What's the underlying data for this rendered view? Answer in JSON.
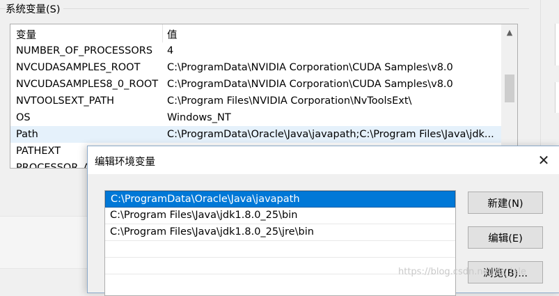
{
  "system_vars": {
    "group_title": "系统变量(S)",
    "header_variable": "变量",
    "header_value": "值",
    "rows": [
      {
        "name": "NUMBER_OF_PROCESSORS",
        "value": "4"
      },
      {
        "name": "NVCUDASAMPLES_ROOT",
        "value": "C:\\ProgramData\\NVIDIA Corporation\\CUDA Samples\\v8.0"
      },
      {
        "name": "NVCUDASAMPLES8_0_ROOT",
        "value": "C:\\ProgramData\\NVIDIA Corporation\\CUDA Samples\\v8.0"
      },
      {
        "name": "NVTOOLSEXT_PATH",
        "value": "C:\\Program Files\\NVIDIA Corporation\\NvToolsExt\\"
      },
      {
        "name": "OS",
        "value": "Windows_NT"
      },
      {
        "name": "Path",
        "value": "C:\\ProgramData\\Oracle\\Java\\javapath;C:\\Program Files\\Java\\jdk..."
      },
      {
        "name": "PATHEXT",
        "value": ""
      },
      {
        "name": "PROCESSOR_A",
        "value": ""
      }
    ]
  },
  "edit_dialog": {
    "title": "编辑环境变量",
    "close_glyph": "✕",
    "paths": [
      "C:\\ProgramData\\Oracle\\Java\\javapath",
      "C:\\Program Files\\Java\\jdk1.8.0_25\\bin",
      "C:\\Program Files\\Java\\jdk1.8.0_25\\jre\\bin"
    ],
    "buttons": {
      "new": "新建(N)",
      "edit": "编辑(E)",
      "browse": "浏览(B)..."
    }
  },
  "watermark": "https://blog.csdn.net/dz_lele",
  "colors": {
    "selection": "#0078d7",
    "row_highlight": "#e5f1fb"
  }
}
